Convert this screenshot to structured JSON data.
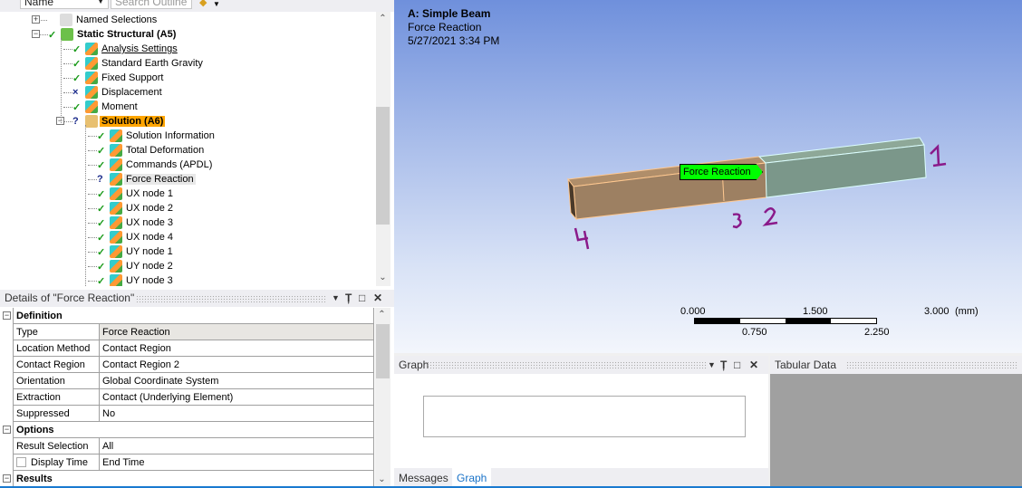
{
  "outline": {
    "toolbar": {
      "name_select": "Name",
      "search_placeholder": "Search Outline"
    },
    "items": [
      {
        "label": "Named Selections",
        "status": "",
        "bold": false
      },
      {
        "label": "Static Structural (A5)",
        "status": "ok",
        "bold": true
      },
      {
        "label": "Analysis Settings",
        "status": "ok"
      },
      {
        "label": "Standard Earth Gravity",
        "status": "ok"
      },
      {
        "label": "Fixed Support",
        "status": "ok"
      },
      {
        "label": "Displacement",
        "status": "x"
      },
      {
        "label": "Moment",
        "status": "ok"
      },
      {
        "label": "Solution (A6)",
        "status": "?",
        "bold": true
      },
      {
        "label": "Solution Information",
        "status": "ok"
      },
      {
        "label": "Total Deformation",
        "status": "ok"
      },
      {
        "label": "Commands (APDL)",
        "status": "ok"
      },
      {
        "label": "Force Reaction",
        "status": "?"
      },
      {
        "label": "UX node 1",
        "status": "ok"
      },
      {
        "label": "UX node 2",
        "status": "ok"
      },
      {
        "label": "UX node 3",
        "status": "ok"
      },
      {
        "label": "UX node 4",
        "status": "ok"
      },
      {
        "label": "UY node 1",
        "status": "ok"
      },
      {
        "label": "UY node 2",
        "status": "ok"
      },
      {
        "label": "UY node 3",
        "status": "ok"
      }
    ]
  },
  "details": {
    "title": "Details of \"Force Reaction\"",
    "groups": {
      "definition": "Definition",
      "options": "Options",
      "results": "Results"
    },
    "rows": [
      {
        "k": "Type",
        "v": "Force Reaction"
      },
      {
        "k": "Location Method",
        "v": "Contact Region"
      },
      {
        "k": "Contact Region",
        "v": "Contact Region 2"
      },
      {
        "k": "Orientation",
        "v": "Global Coordinate System"
      },
      {
        "k": "Extraction",
        "v": "Contact (Underlying Element)"
      },
      {
        "k": "Suppressed",
        "v": "No"
      },
      {
        "k": "Result Selection",
        "v": "All"
      },
      {
        "k": "Display Time",
        "v": "End Time"
      }
    ]
  },
  "viewport": {
    "title": "A: Simple Beam",
    "subtitle": "Force Reaction",
    "timestamp": "5/27/2021 3:34 PM",
    "label": "Force Reaction",
    "annotations": [
      "1",
      "2",
      "3",
      "4"
    ],
    "scale": {
      "t0": "0.000",
      "t1": "1.500",
      "t2": "3.000",
      "unit": "(mm)",
      "b1": "0.750",
      "b2": "2.250"
    }
  },
  "graph": {
    "title": "Graph",
    "tabs": [
      "Messages",
      "Graph"
    ]
  },
  "tabular": {
    "title": "Tabular Data"
  },
  "colors": {
    "selected": "#ffa500",
    "label_bg": "#00ff00",
    "annotation": "#8a1a8a"
  }
}
